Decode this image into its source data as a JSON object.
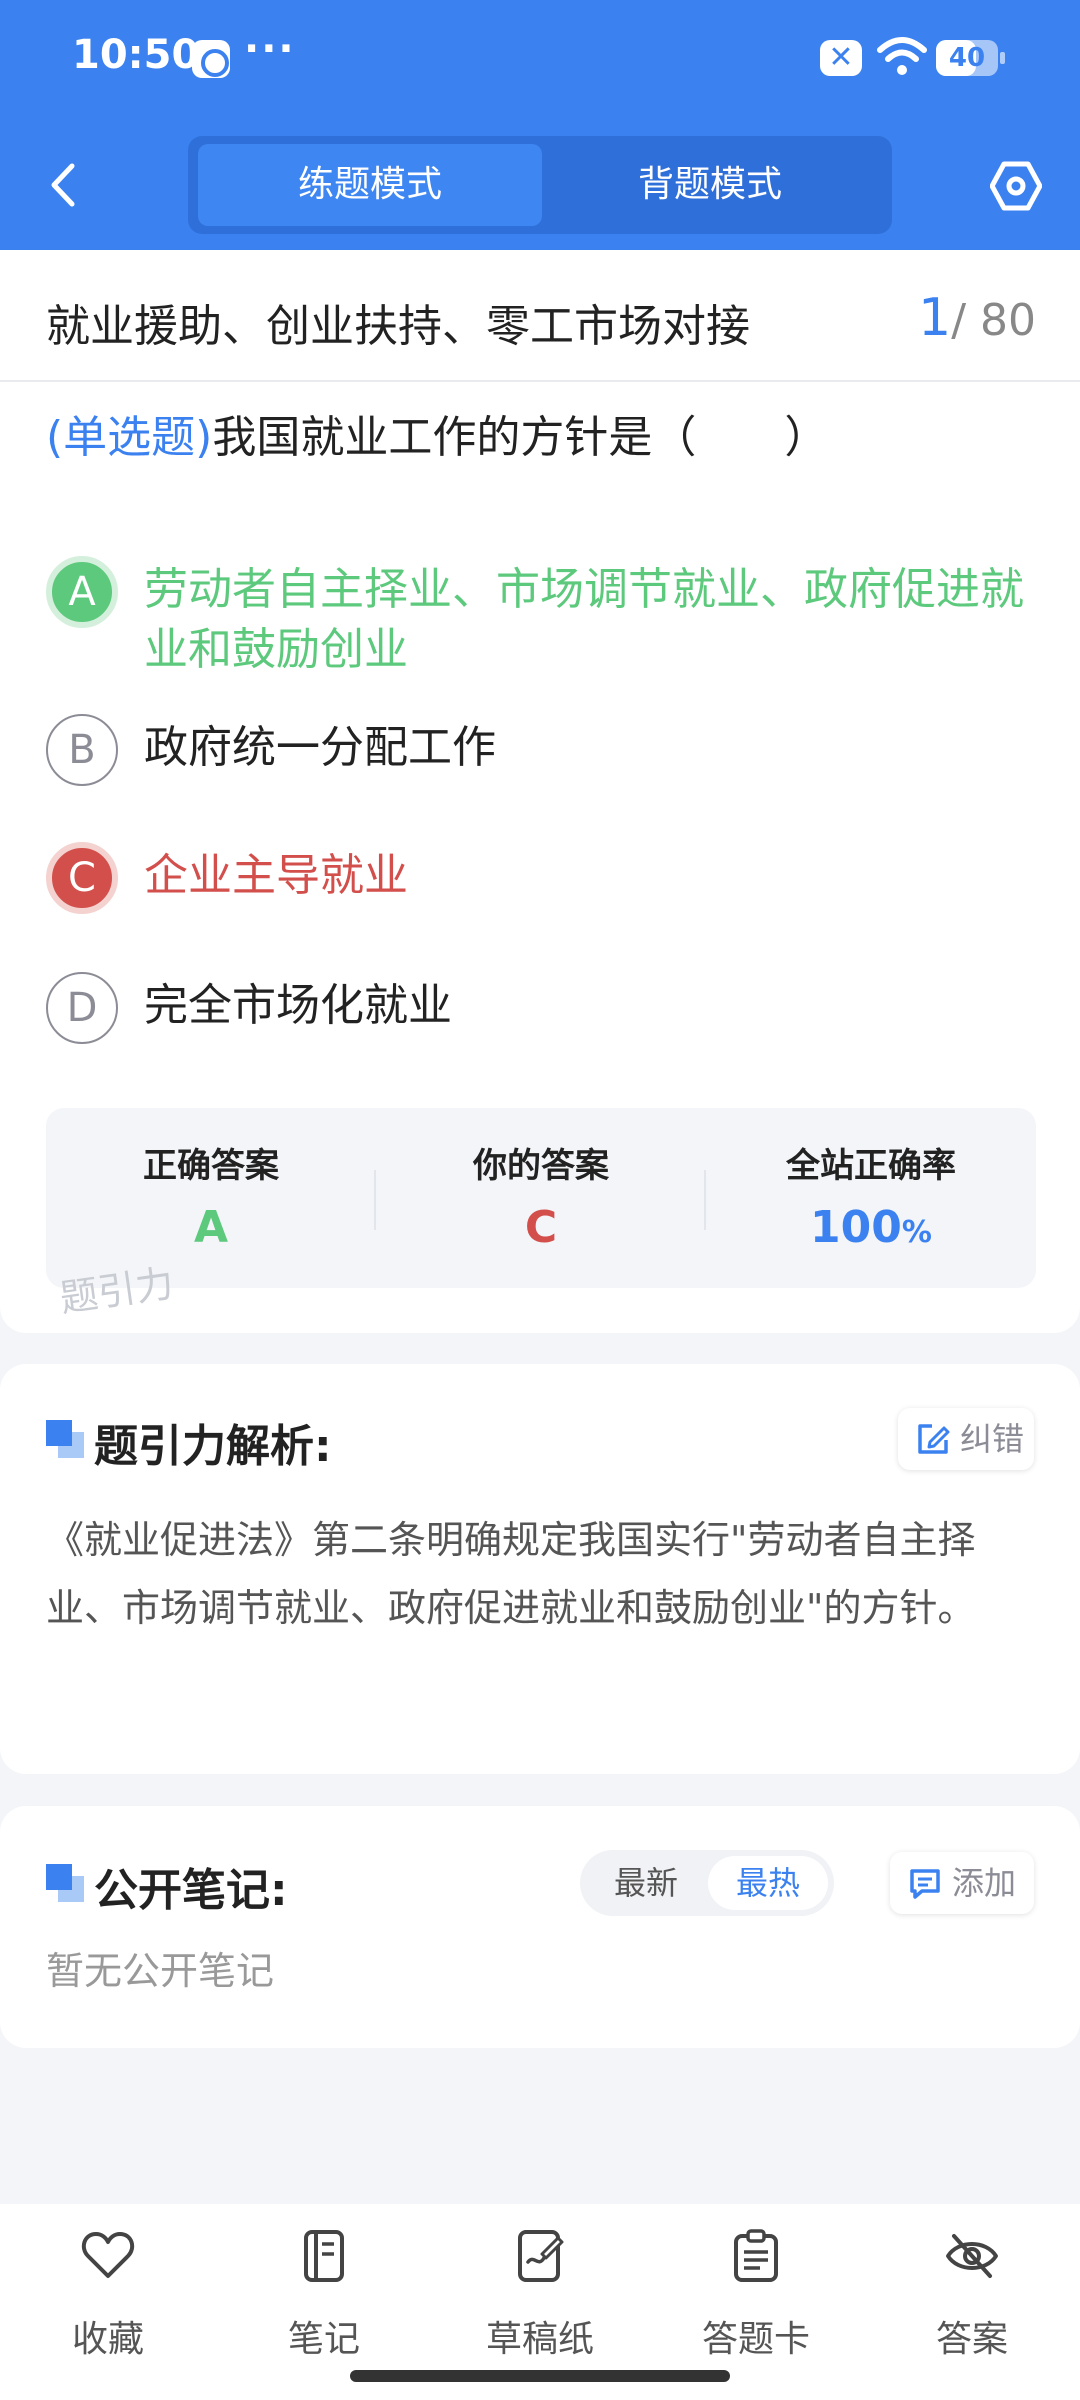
{
  "status_bar": {
    "time": "10:50",
    "more": "···",
    "battery": "40"
  },
  "header": {
    "tabs": [
      {
        "label": "练题模式",
        "active": true
      },
      {
        "label": "背题模式",
        "active": false
      }
    ]
  },
  "question": {
    "section_title": "就业援助、创业扶持、零工市场对接",
    "current": "1",
    "total": "/ 80",
    "type": "(单选题)",
    "text": "我国就业工作的方针是（　　）",
    "options": [
      {
        "letter": "A",
        "text": "劳动者自主择业、市场调节就业、政府促进就业和鼓励创业",
        "state": "correct"
      },
      {
        "letter": "B",
        "text": "政府统一分配工作",
        "state": "normal"
      },
      {
        "letter": "C",
        "text": "企业主导就业",
        "state": "wrong"
      },
      {
        "letter": "D",
        "text": "完全市场化就业",
        "state": "normal"
      }
    ]
  },
  "result": {
    "correct_label": "正确答案",
    "correct_value": "A",
    "yours_label": "你的答案",
    "yours_value": "C",
    "rate_label": "全站正确率",
    "rate_value": "100",
    "rate_unit": "%"
  },
  "watermark": "题引力",
  "analysis": {
    "title": "题引力解析:",
    "report_label": "纠错",
    "text": "《就业促进法》第二条明确规定我国实行\"劳动者自主择业、市场调节就业、政府促进就业和鼓励创业\"的方针。"
  },
  "notes": {
    "title": "公开笔记:",
    "sort_options": [
      "最新",
      "最热"
    ],
    "selected_sort": "最热",
    "add_label": "添加",
    "empty_text": "暂无公开笔记"
  },
  "bottom_nav": [
    {
      "label": "收藏",
      "icon": "heart-icon"
    },
    {
      "label": "笔记",
      "icon": "notebook-icon"
    },
    {
      "label": "草稿纸",
      "icon": "draft-icon"
    },
    {
      "label": "答题卡",
      "icon": "answer-card-icon"
    },
    {
      "label": "答案",
      "icon": "eye-off-icon"
    }
  ],
  "colors": {
    "primary": "#3b82f0",
    "correct": "#5dc97d",
    "wrong": "#d24f4c"
  }
}
